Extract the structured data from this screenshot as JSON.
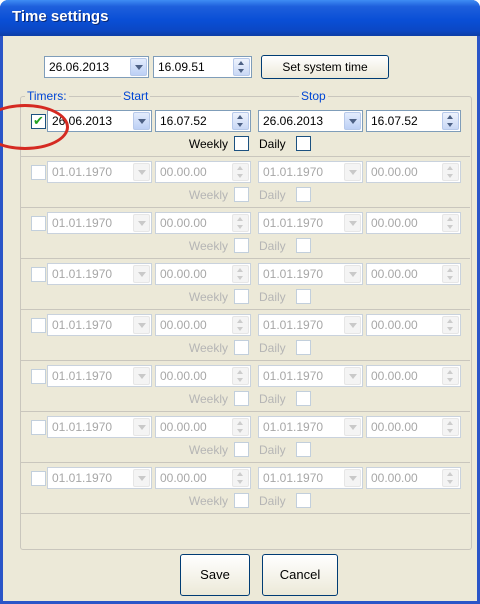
{
  "window": {
    "title": "Time settings"
  },
  "system": {
    "date": "26.06.2013",
    "time": "16.09.51",
    "set_button": "Set system time"
  },
  "headers": {
    "timers": "Timers:",
    "start": "Start",
    "stop": "Stop"
  },
  "timers": [
    {
      "enabled": true,
      "start_date": "26.06.2013",
      "start_time": "16.07.52",
      "stop_date": "26.06.2013",
      "stop_time": "16.07.52",
      "weekly": "Weekly",
      "daily": "Daily"
    },
    {
      "enabled": false,
      "start_date": "01.01.1970",
      "start_time": "00.00.00",
      "stop_date": "01.01.1970",
      "stop_time": "00.00.00",
      "weekly": "Weekly",
      "daily": "Daily"
    },
    {
      "enabled": false,
      "start_date": "01.01.1970",
      "start_time": "00.00.00",
      "stop_date": "01.01.1970",
      "stop_time": "00.00.00",
      "weekly": "Weekly",
      "daily": "Daily"
    },
    {
      "enabled": false,
      "start_date": "01.01.1970",
      "start_time": "00.00.00",
      "stop_date": "01.01.1970",
      "stop_time": "00.00.00",
      "weekly": "Weekly",
      "daily": "Daily"
    },
    {
      "enabled": false,
      "start_date": "01.01.1970",
      "start_time": "00.00.00",
      "stop_date": "01.01.1970",
      "stop_time": "00.00.00",
      "weekly": "Weekly",
      "daily": "Daily"
    },
    {
      "enabled": false,
      "start_date": "01.01.1970",
      "start_time": "00.00.00",
      "stop_date": "01.01.1970",
      "stop_time": "00.00.00",
      "weekly": "Weekly",
      "daily": "Daily"
    },
    {
      "enabled": false,
      "start_date": "01.01.1970",
      "start_time": "00.00.00",
      "stop_date": "01.01.1970",
      "stop_time": "00.00.00",
      "weekly": "Weekly",
      "daily": "Daily"
    },
    {
      "enabled": false,
      "start_date": "01.01.1970",
      "start_time": "00.00.00",
      "stop_date": "01.01.1970",
      "stop_time": "00.00.00",
      "weekly": "Weekly",
      "daily": "Daily"
    }
  ],
  "buttons": {
    "save": "Save",
    "cancel": "Cancel"
  },
  "colors": {
    "titlebar": "#0a4fd6",
    "window_bg": "#ece9d8",
    "annotation_circle": "#d52a22",
    "check": "#21a121"
  }
}
